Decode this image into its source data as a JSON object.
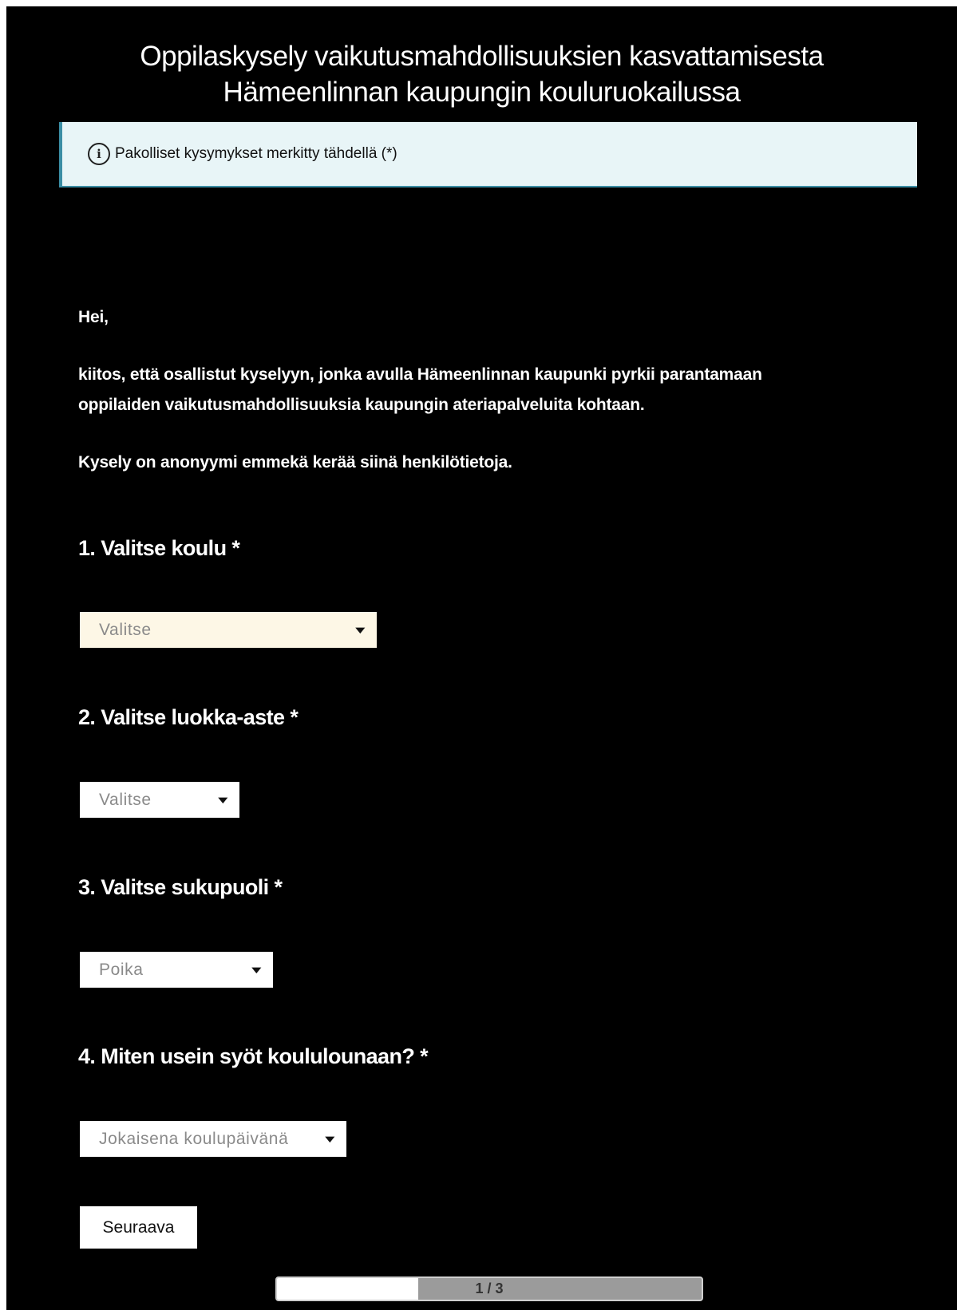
{
  "survey": {
    "title_line1": "Oppilaskysely vaikutusmahdollisuuksien kasvattamisesta",
    "title_line2": "Hämeenlinnan kaupungin kouluruokailussa",
    "notice": {
      "icon": "info-icon",
      "text": "Pakolliset kysymykset merkitty tähdellä (*)"
    },
    "intro": {
      "greeting": "Hei,",
      "paragraph_line1": "kiitos, että osallistut kyselyyn, jonka avulla Hämeenlinnan kaupunki pyrkii parantamaan",
      "paragraph_line2": "oppilaiden vaikutusmahdollisuuksia kaupungin ateriapalveluita kohtaan.",
      "privacy": "Kysely on anonyymi emmekä kerää siinä henkilötietoja."
    },
    "questions": [
      {
        "label": "1. Valitse koulu *",
        "selected": "Valitse"
      },
      {
        "label": "2. Valitse luokka-aste *",
        "selected": "Valitse"
      },
      {
        "label": "3. Valitse sukupuoli *",
        "selected": "Poika"
      },
      {
        "label": "4. Miten usein syöt koululounaan? *",
        "selected": "Jokaisena koulupäivänä"
      }
    ],
    "next_button": "Seuraava",
    "progress": {
      "label": "1 / 3",
      "fraction": 0.333
    }
  },
  "colors": {
    "background": "#000000",
    "notice_background": "#e8f5f7",
    "notice_border": "#3b8ea5",
    "highlight_select": "#fdf7e6"
  }
}
